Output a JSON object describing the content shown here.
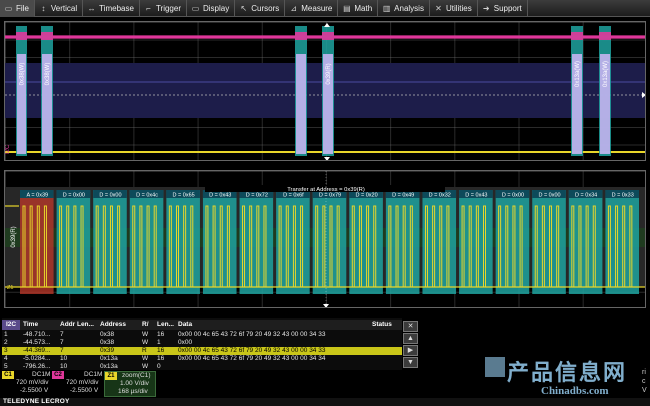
{
  "menu": [
    {
      "label": "File",
      "icon": "folder-icon",
      "glyph": "▭"
    },
    {
      "label": "Vertical",
      "icon": "vertical-arrows-icon",
      "glyph": "↕"
    },
    {
      "label": "Timebase",
      "icon": "horizontal-arrows-icon",
      "glyph": "↔"
    },
    {
      "label": "Trigger",
      "icon": "trigger-icon",
      "glyph": "⌐"
    },
    {
      "label": "Display",
      "icon": "display-icon",
      "glyph": "▭"
    },
    {
      "label": "Cursors",
      "icon": "cursor-icon",
      "glyph": "↖"
    },
    {
      "label": "Measure",
      "icon": "measure-icon",
      "glyph": "⊿"
    },
    {
      "label": "Math",
      "icon": "math-icon",
      "glyph": "▤"
    },
    {
      "label": "Analysis",
      "icon": "analysis-icon",
      "glyph": "▥"
    },
    {
      "label": "Utilities",
      "icon": "tools-icon",
      "glyph": "✕"
    },
    {
      "label": "Support",
      "icon": "support-icon",
      "glyph": "➜"
    }
  ],
  "top_labels": {
    "i2c": "I2C",
    "pkt1": "0x38(W)",
    "pkt2": "0x38(W)",
    "pkt3": "0x39(R)",
    "pkt4": "0x13a(W)",
    "pkt5": "0x13a(W)"
  },
  "bottom_header": "Transfer at Address = 0x39(R)",
  "bottom_first_label": "0x39(R)",
  "bottom_side_label": "Z1",
  "cells": [
    {
      "label": "A = 0x39",
      "kind": "addr"
    },
    {
      "label": "D = 0x00",
      "kind": "data"
    },
    {
      "label": "D = 0x00",
      "kind": "data"
    },
    {
      "label": "D = 0x4c",
      "kind": "data"
    },
    {
      "label": "D = 0x65",
      "kind": "data"
    },
    {
      "label": "D = 0x43",
      "kind": "data"
    },
    {
      "label": "D = 0x72",
      "kind": "data"
    },
    {
      "label": "D = 0x6f",
      "kind": "data"
    },
    {
      "label": "D = 0x79",
      "kind": "data"
    },
    {
      "label": "D = 0x20",
      "kind": "data"
    },
    {
      "label": "D = 0x49",
      "kind": "data"
    },
    {
      "label": "D = 0x32",
      "kind": "data"
    },
    {
      "label": "D = 0x43",
      "kind": "data"
    },
    {
      "label": "D = 0x00",
      "kind": "data"
    },
    {
      "label": "D = 0x00",
      "kind": "data"
    },
    {
      "label": "D = 0x34",
      "kind": "data"
    },
    {
      "label": "D = 0x33",
      "kind": "data"
    }
  ],
  "table": {
    "tag": "I2C",
    "headers": {
      "time": "Time",
      "al": "Addr Len...",
      "addr": "Address",
      "rw": "R/",
      "len": "Len...",
      "data": "Data",
      "status": "Status"
    },
    "rows": [
      {
        "idx": "1",
        "time": "-48.710...",
        "al": "7",
        "addr": "0x38",
        "rw": "W",
        "len": "16",
        "data": "0x00 00 4c 65 43 72 6f 79 20 49 32 43 00 00 34 33",
        "selected": false
      },
      {
        "idx": "2",
        "time": "-44.573...",
        "al": "7",
        "addr": "0x38",
        "rw": "W",
        "len": "1",
        "data": "0x00",
        "selected": false
      },
      {
        "idx": "3",
        "time": "-44.369...",
        "al": "7",
        "addr": "0x39",
        "rw": "R",
        "len": "16",
        "data": "0x00 00 4c 65 43 72 6f 79 20 49 32 43 00 00 34 33",
        "selected": true
      },
      {
        "idx": "4",
        "time": "-5.0284...",
        "al": "10",
        "addr": "0x13a",
        "rw": "W",
        "len": "16",
        "data": "0x00 00 4c 65 43 72 6f 79 20 49 32 43 00 00 34 34",
        "selected": false
      },
      {
        "idx": "5",
        "time": "-796.26...",
        "al": "10",
        "addr": "0x13a",
        "rw": "W",
        "len": "0",
        "data": "",
        "selected": false
      }
    ]
  },
  "side_buttons": [
    "✕",
    "▲",
    "▶",
    "▼"
  ],
  "descriptors": {
    "c1": {
      "tag": "C1",
      "coupling": "DC1M",
      "vdiv": "720 mV/div",
      "offset": "-2.5500 V",
      "color": "#e8d62a"
    },
    "c2": {
      "tag": "C2",
      "coupling": "DC1M",
      "vdiv": "720 mV/div",
      "offset": "-2.5500 V",
      "color": "#e0379a"
    },
    "z1": {
      "tag": "Z1",
      "title": "zoom(C1)",
      "vdiv": "1.00 V/div",
      "tdiv": "168 µs/div",
      "color": "#e8d62a"
    }
  },
  "right_letters": [
    "ri",
    "c",
    "V"
  ],
  "brand": "TELEDYNE LECROY",
  "watermark": {
    "cn": "产品信息网",
    "en": "Chinadbs.com"
  },
  "colors": {
    "c1": "#e8d62a",
    "c2": "#e0379a",
    "packet": "#c4b3f0",
    "teal": "#1fa3a0",
    "addr": "#c0392b",
    "selected": "#c9c619"
  }
}
